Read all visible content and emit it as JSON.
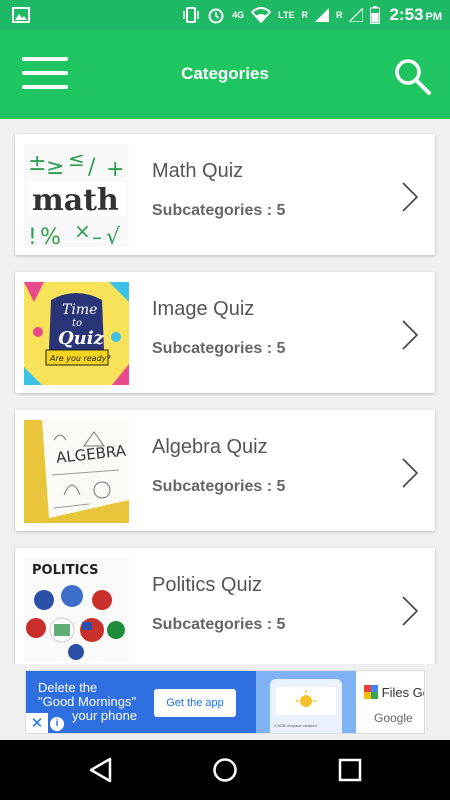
{
  "status_bar": {
    "time": "2:53",
    "ampm": "PM",
    "network_4g": "4G",
    "network_lte": "LTE",
    "roaming_1": "R",
    "roaming_2": "R"
  },
  "app_bar": {
    "title": "Categories"
  },
  "categories": [
    {
      "name": "Math Quiz",
      "subcategories": "Subcategories : 5",
      "icon": "math-thumbnail"
    },
    {
      "name": "Image Quiz",
      "subcategories": "Subcategories : 5",
      "icon": "time-to-quiz-thumbnail"
    },
    {
      "name": "Algebra Quiz",
      "subcategories": "Subcategories : 5",
      "icon": "algebra-thumbnail"
    },
    {
      "name": "Politics Quiz",
      "subcategories": "Subcategories : 5",
      "icon": "politics-thumbnail"
    }
  ],
  "thumbnails": {
    "math_text": "math",
    "quiz_time": "Time",
    "quiz_to": "to",
    "quiz_quiz": "Quiz",
    "quiz_ready": "Are you ready?",
    "algebra_text": "ALGEBRA",
    "politics_text": "POLITICS"
  },
  "ad": {
    "line1": "Delete the",
    "line2": "\"Good Mornings\"",
    "line3": "your phone",
    "cta": "Get the app",
    "product": "Files Go",
    "brand": "Google",
    "phone_caption": "2.9GB of space cleaned"
  },
  "colors": {
    "accent": "#1fc561",
    "status_bar": "#1fb864",
    "ad_blue": "#2f6fe0"
  }
}
